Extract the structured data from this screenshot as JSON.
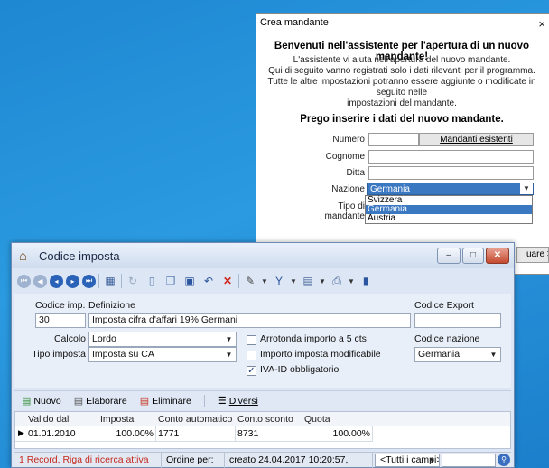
{
  "back_dialog": {
    "title": "Crea mandante",
    "close_glyph": "×",
    "welcome": "Benvenuti nell'assistente per l'apertura di un nuovo mandante!",
    "intro_lines": [
      "L'assistente vi aiuta nell'apertura del nuovo mandante.",
      "Qui di seguito vanno registrati solo i dati rilevanti per il programma.",
      "Tutte le altre impostazioni potranno essere aggiunte o modificate in seguito nelle",
      "impostazioni del mandante."
    ],
    "prompt": "Prego inserire i dati del nuovo mandante.",
    "fields": {
      "numero_label": "Numero",
      "existing_button": "Mandanti esistenti",
      "cognome_label": "Cognome",
      "ditta_label": "Ditta",
      "nazione_label": "Nazione",
      "nazione_value": "Germania",
      "tipo_label": "Tipo di mandante"
    },
    "nazione_options": [
      "Svizzera",
      "Germania",
      "Austria"
    ],
    "partial_button": "uare >"
  },
  "window": {
    "title": "Codice imposta",
    "controls": {
      "minimize": "–",
      "maximize": "□",
      "close": "✕"
    },
    "form": {
      "codice_label": "Codice imp.",
      "codice_value": "30",
      "definizione_label": "Definizione",
      "definizione_value": "Imposta cifra d'affari 19% Germani",
      "export_label": "Codice Export",
      "export_value": "",
      "calcolo_label": "Calcolo",
      "calcolo_value": "Lordo",
      "tipo_label": "Tipo imposta",
      "tipo_value": "Imposta su CA",
      "arrotonda_label": "Arrotonda importo a 5 cts",
      "importo_label": "Importo imposta modificabile",
      "iva_label": "IVA-ID obbligatorio",
      "nazione_label": "Codice nazione",
      "nazione_value": "Germania"
    },
    "subtoolbar": {
      "nuovo": "Nuovo",
      "elaborare": "Elaborare",
      "eliminare": "Eliminare",
      "diversi": "Diversi"
    },
    "grid": {
      "headers": [
        "Valido dal",
        "Imposta",
        "Conto automatico",
        "Conto sconto",
        "Quota"
      ],
      "rows": [
        [
          "01.01.2010",
          "100.00%",
          "1771",
          "8731",
          "100.00%"
        ]
      ]
    },
    "status": {
      "record": "1 Record, Riga di ricerca attiva",
      "ordine": "Ordine per:",
      "creato": "creato 24.04.2017 10:20:57,",
      "campi": "<Tutti i campi>"
    }
  }
}
